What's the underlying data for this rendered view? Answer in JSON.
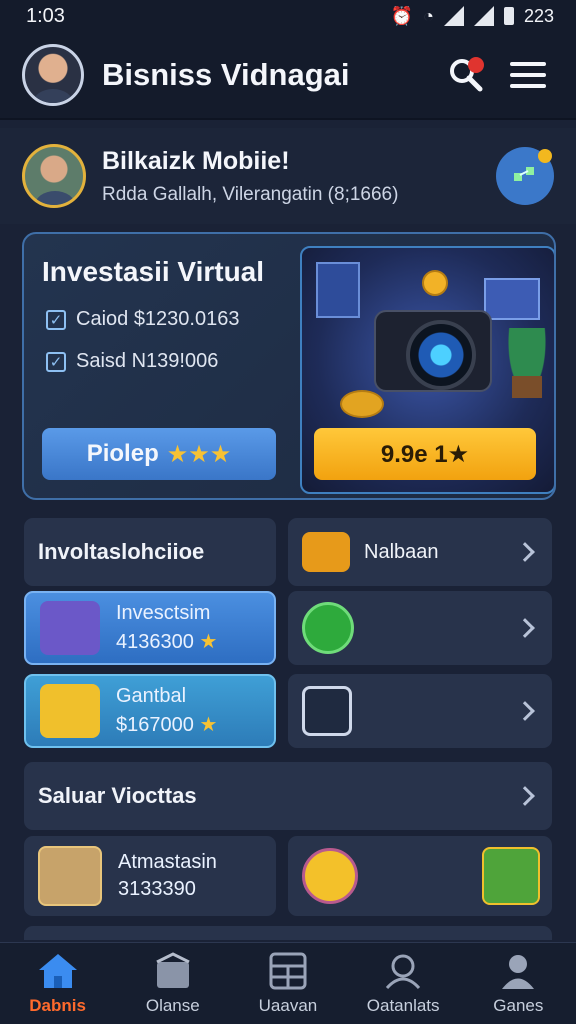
{
  "status": {
    "time": "1:03",
    "battery_text": "223"
  },
  "header": {
    "title": "Bisniss Vidnagai"
  },
  "profile": {
    "name": "Bilkaizk Mobiie!",
    "subtitle": "Rdda Gallalh, Vilerangatin (8;1666)"
  },
  "hero": {
    "title": "Investasii Virtual",
    "check1": "Caiod $1230.0163",
    "check2": "Saisd N139!006",
    "primary_button": "Piolep",
    "primary_stars": "★★★",
    "secondary_button": "9.9e 1★"
  },
  "tiles": {
    "row1_left": "Involtaslohciioe",
    "row1_right": "Nalbaan",
    "row2_left_l1": "Invesctsim",
    "row2_left_l2": "4136300",
    "row3_left_l1": "Gantbal",
    "row3_left_l2": "$167000",
    "section_label": "Saluar Viocttas",
    "row5_left_l1": "Atmastasin",
    "row5_left_l2": "3133390"
  },
  "nav": {
    "items": [
      {
        "label": "Dabnis"
      },
      {
        "label": "Olanse"
      },
      {
        "label": "Uaavan"
      },
      {
        "label": "Oatanlats"
      },
      {
        "label": "Ganes"
      }
    ]
  },
  "colors": {
    "accent_blue": "#3a76c8",
    "accent_orange": "#f2a20f",
    "active_nav": "#ff6a2c"
  }
}
